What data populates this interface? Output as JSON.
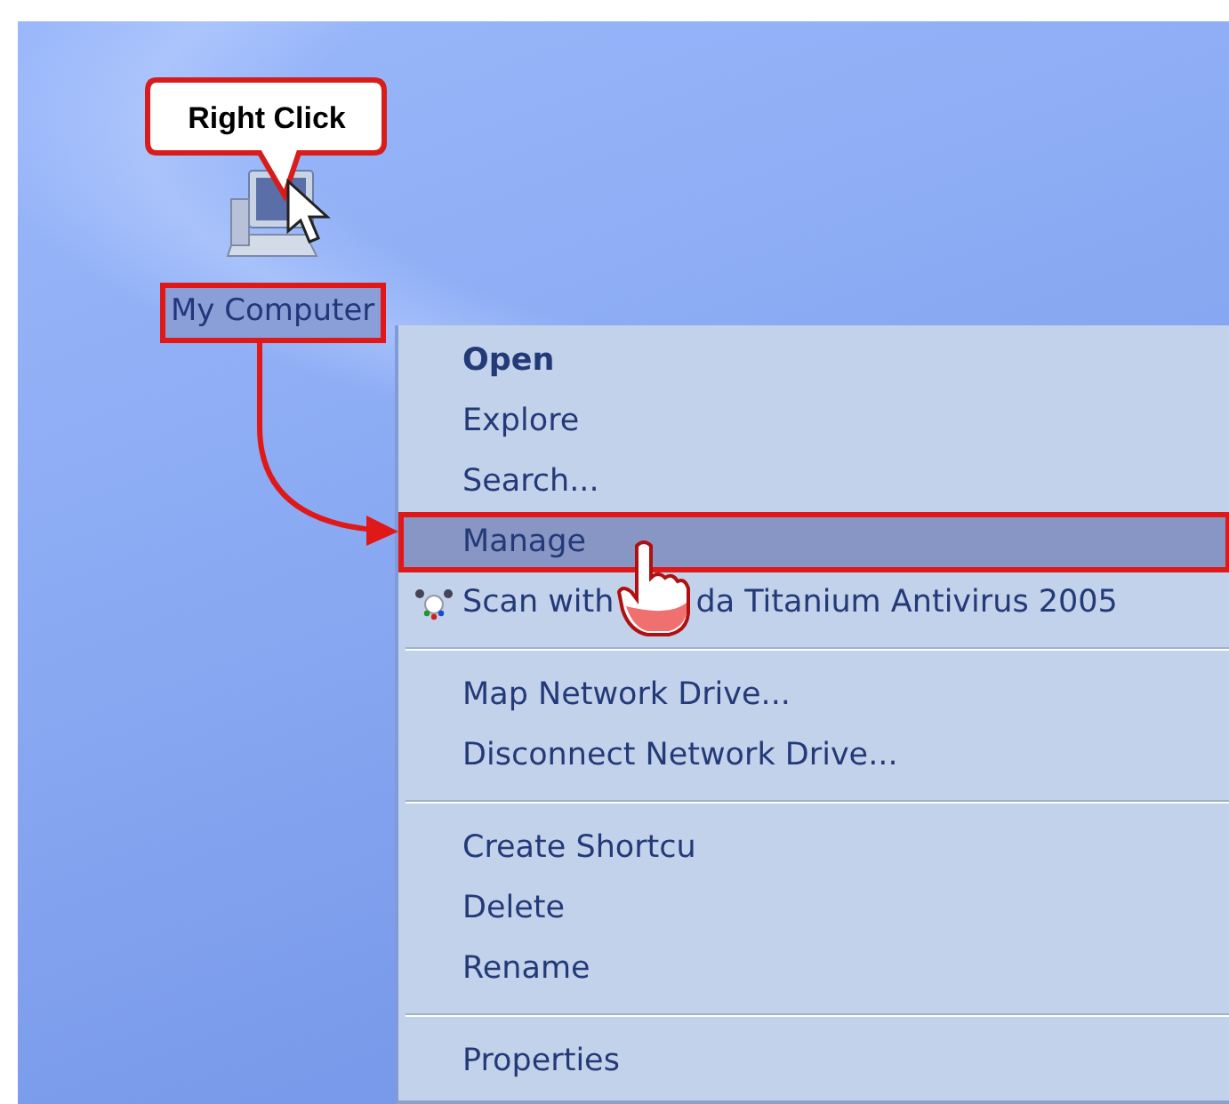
{
  "desktop": {
    "icons": [
      {
        "label": "My Computer",
        "highlight_box": true
      }
    ]
  },
  "callout": {
    "text": "Right Click"
  },
  "context_menu": {
    "items": [
      {
        "kind": "item",
        "label": "Open",
        "default": true,
        "selected": false,
        "highlight_box": false
      },
      {
        "kind": "item",
        "label": "Explore",
        "default": false,
        "selected": false,
        "highlight_box": false
      },
      {
        "kind": "item",
        "label": "Search...",
        "default": false,
        "selected": false,
        "highlight_box": false
      },
      {
        "kind": "item",
        "label": "Manage",
        "default": false,
        "selected": true,
        "highlight_box": true
      },
      {
        "kind": "icon_item",
        "label_parts": [
          "Scan with",
          "da Titanium Antivirus 2005"
        ],
        "default": false,
        "selected": false,
        "highlight_box": false
      },
      {
        "kind": "separator"
      },
      {
        "kind": "item",
        "label": "Map Network Drive...",
        "default": false,
        "selected": false,
        "highlight_box": false
      },
      {
        "kind": "item",
        "label": "Disconnect Network Drive...",
        "default": false,
        "selected": false,
        "highlight_box": false
      },
      {
        "kind": "separator"
      },
      {
        "kind": "item",
        "label": "Create Shortcu",
        "default": false,
        "selected": false,
        "highlight_box": false
      },
      {
        "kind": "item",
        "label": "Delete",
        "default": false,
        "selected": false,
        "highlight_box": false
      },
      {
        "kind": "item",
        "label": "Rename",
        "default": false,
        "selected": false,
        "highlight_box": false
      },
      {
        "kind": "separator"
      },
      {
        "kind": "item",
        "label": "Properties",
        "default": false,
        "selected": false,
        "highlight_box": false
      }
    ]
  }
}
